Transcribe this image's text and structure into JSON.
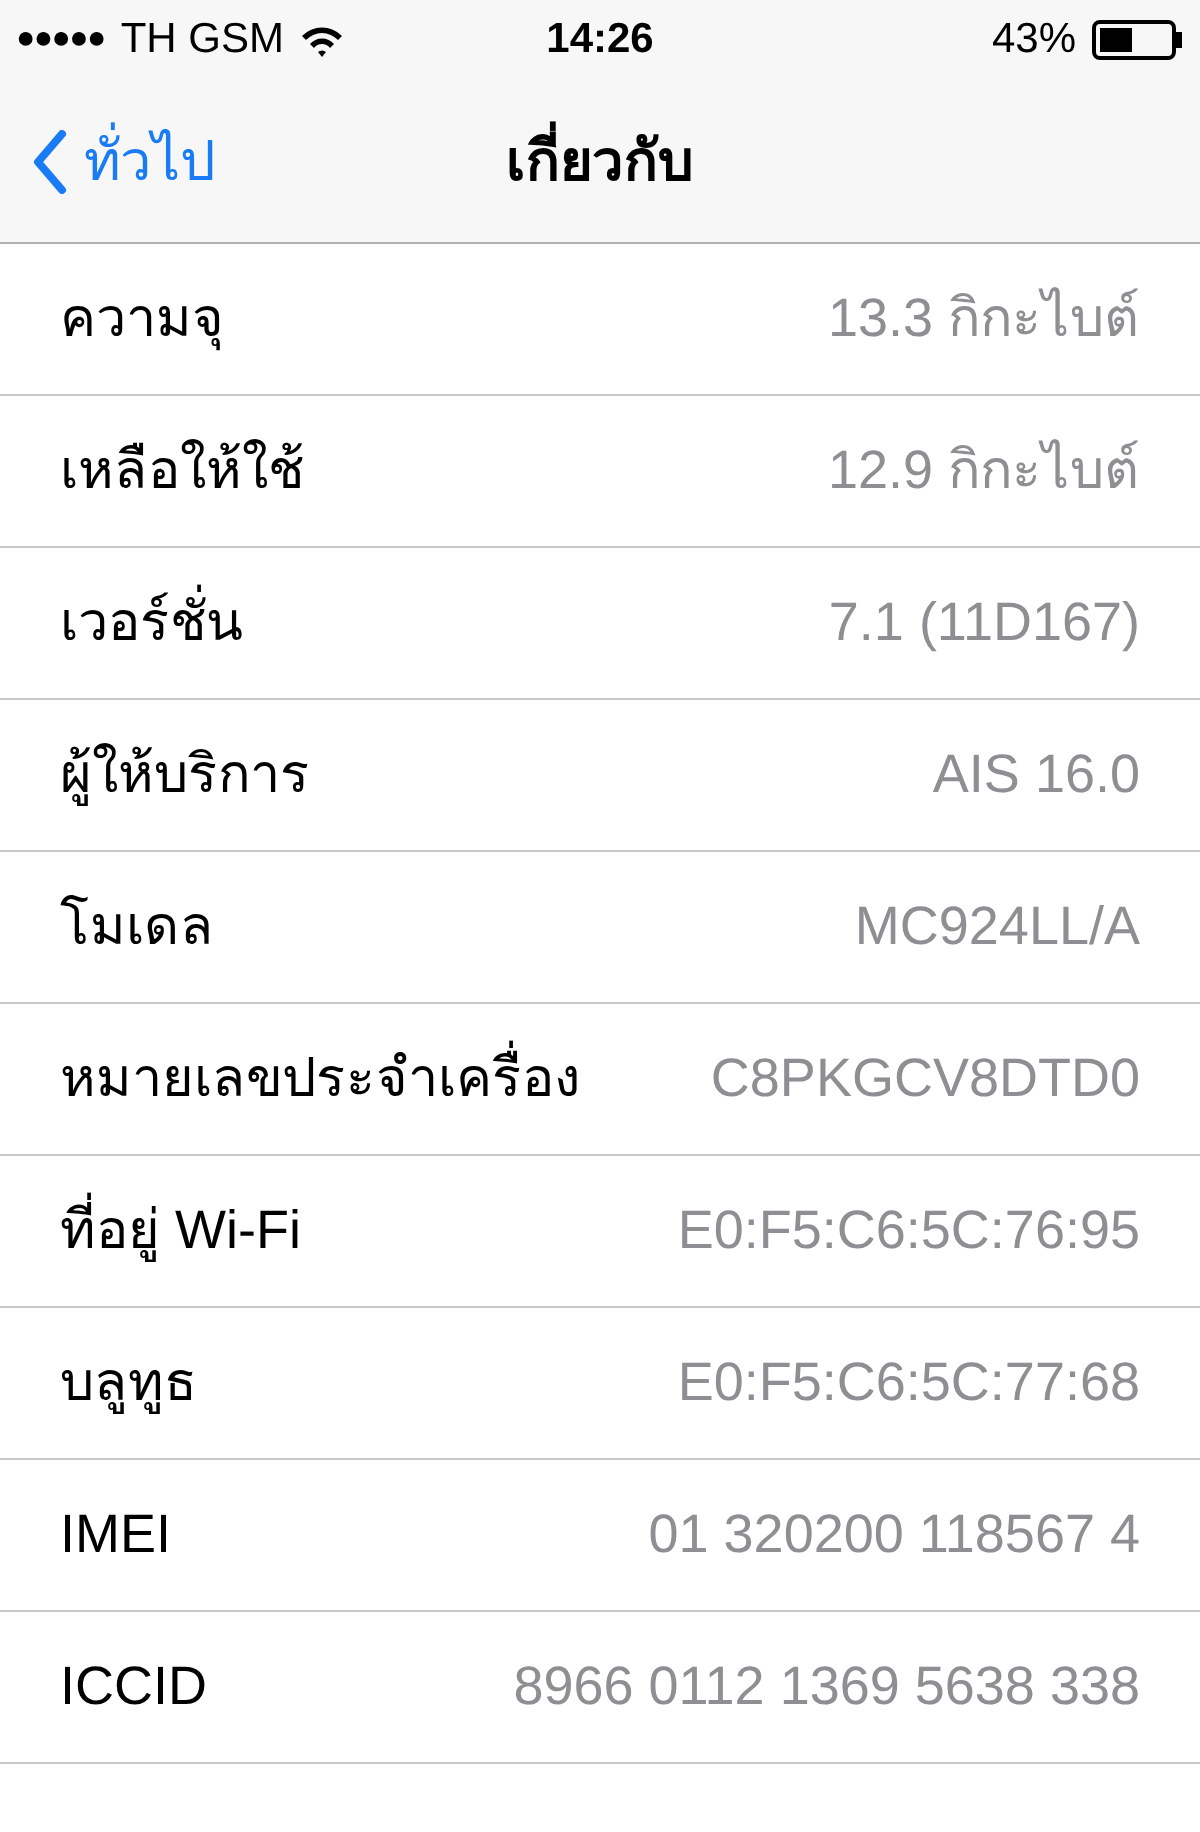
{
  "status_bar": {
    "signal": "●●●●●",
    "carrier": "TH GSM",
    "time": "14:26",
    "battery": "43%"
  },
  "nav": {
    "back": "ทั่วไป",
    "title": "เกี่ยวกับ"
  },
  "rows": [
    {
      "label": "ความจุ",
      "value": "13.3 กิกะไบต์"
    },
    {
      "label": "เหลือให้ใช้",
      "value": "12.9 กิกะไบต์"
    },
    {
      "label": "เวอร์ชั่น",
      "value": "7.1 (11D167)"
    },
    {
      "label": "ผู้ให้บริการ",
      "value": "AIS 16.0"
    },
    {
      "label": "โมเดล",
      "value": "MC924LL/A"
    },
    {
      "label": "หมายเลขประจำเครื่อง",
      "value": "C8PKGCV8DTD0"
    },
    {
      "label": "ที่อยู่ Wi-Fi",
      "value": "E0:F5:C6:5C:76:95"
    },
    {
      "label": "บลูทูธ",
      "value": "E0:F5:C6:5C:77:68"
    },
    {
      "label": "IMEI",
      "value": "01 320200 118567 4"
    },
    {
      "label": "ICCID",
      "value": "8966 0112 1369 5638 338"
    }
  ]
}
